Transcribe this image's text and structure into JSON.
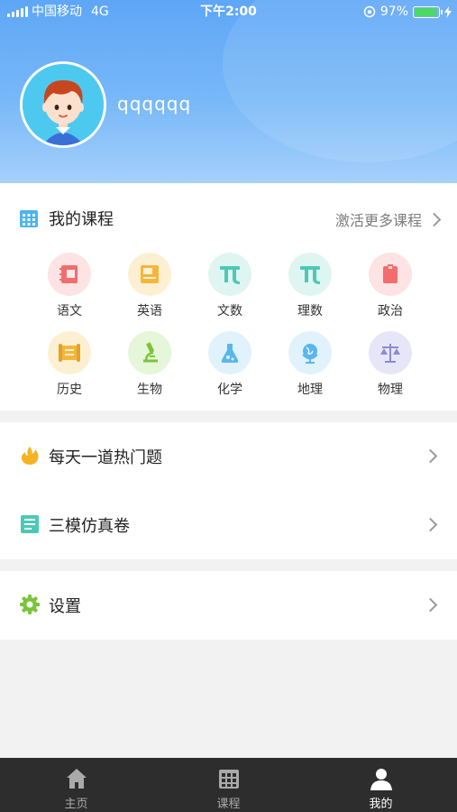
{
  "status_bar": {
    "carrier": "中国移动",
    "network": "4G",
    "time": "下午2:00",
    "battery": "97%"
  },
  "profile": {
    "username": "qqqqqq"
  },
  "courses": {
    "title": "我的课程",
    "more_label": "激活更多课程",
    "subjects": [
      {
        "label": "语文",
        "icon": "chinese-book-icon",
        "bg": "#fde3e3",
        "color": "#f26d6d"
      },
      {
        "label": "英语",
        "icon": "english-book-icon",
        "bg": "#fdf0d2",
        "color": "#f5b63a"
      },
      {
        "label": "文数",
        "icon": "pi-icon",
        "bg": "#dff5f2",
        "color": "#4cc9b5"
      },
      {
        "label": "理数",
        "icon": "pi-icon",
        "bg": "#dff5f2",
        "color": "#4cc9b5"
      },
      {
        "label": "政治",
        "icon": "red-book-icon",
        "bg": "#fde3e3",
        "color": "#f26d6d"
      },
      {
        "label": "历史",
        "icon": "scroll-icon",
        "bg": "#fdf0d2",
        "color": "#f5b63a"
      },
      {
        "label": "生物",
        "icon": "microscope-icon",
        "bg": "#e6f6d8",
        "color": "#7cc43b"
      },
      {
        "label": "化学",
        "icon": "flask-icon",
        "bg": "#e1f2fc",
        "color": "#59b7ec"
      },
      {
        "label": "地理",
        "icon": "globe-icon",
        "bg": "#e1f2fc",
        "color": "#59b7ec"
      },
      {
        "label": "物理",
        "icon": "scale-icon",
        "bg": "#e7e6f8",
        "color": "#8e88d8"
      }
    ]
  },
  "menu": {
    "hot_question": "每天一道热门题",
    "mock_exam": "三模仿真卷",
    "settings": "设置"
  },
  "tabbar": {
    "home": "主页",
    "courses": "课程",
    "mine": "我的"
  },
  "colors": {
    "header": "#6aaef7",
    "tabbar": "#2d2d2d",
    "active_tab": "#ffffff"
  }
}
